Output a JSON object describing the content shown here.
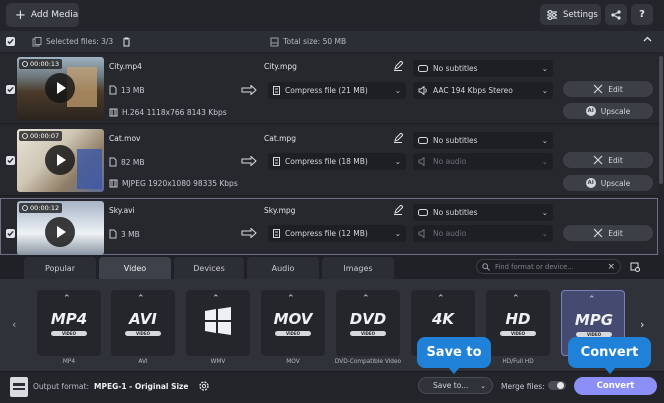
{
  "toolbar": {
    "add_media": "Add Media",
    "settings": "Settings",
    "help": "?"
  },
  "infobar": {
    "selected_files": "Selected files: 3/3",
    "total_size": "Total size: 50 MB"
  },
  "files": [
    {
      "duration": "00:00:13",
      "source_name": "City.mp4",
      "size": "13 MB",
      "codec_info": "H.264 1118x766 8143 Kbps",
      "output_name": "City.mpg",
      "compress": "Compress file (21 MB)",
      "subtitles": "No subtitles",
      "audio": "AAC 194 Kbps Stereo",
      "edit": "Edit",
      "upscale": "Upscale"
    },
    {
      "duration": "00:00:07",
      "source_name": "Cat.mov",
      "size": "82 MB",
      "codec_info": "MJPEG 1920x1080 98335 Kbps",
      "output_name": "Cat.mpg",
      "compress": "Compress file (18 MB)",
      "subtitles": "No subtitles",
      "audio": "No audio",
      "edit": "Edit",
      "upscale": "Upscale"
    },
    {
      "duration": "00:00:12",
      "source_name": "Sky.avi",
      "size": "3 MB",
      "output_name": "Sky.mpg",
      "compress": "Compress file (12 MB)",
      "subtitles": "No subtitles",
      "audio": "No audio",
      "edit": "Edit"
    }
  ],
  "format_tabs": [
    "Popular",
    "Video",
    "Devices",
    "Audio",
    "Images"
  ],
  "active_tab": "Video",
  "search": {
    "placeholder": "Find format or device..."
  },
  "formats": [
    {
      "logo": "MP4",
      "badge": "VIDEO",
      "label": "MP4"
    },
    {
      "logo": "AVI",
      "badge": "VIDEO",
      "label": "AVI"
    },
    {
      "logo": "",
      "badge": "",
      "label": "WMV"
    },
    {
      "logo": "MOV",
      "badge": "VIDEO",
      "label": "MOV"
    },
    {
      "logo": "DVD",
      "badge": "VIDEO",
      "label": "DVD-Compatible Video"
    },
    {
      "logo": "4K",
      "badge": "",
      "label": ""
    },
    {
      "logo": "HD",
      "badge": "VIDEO",
      "label": "HD/Full HD"
    },
    {
      "logo": "MPG",
      "badge": "VIDEO",
      "label": ""
    }
  ],
  "bottom": {
    "output_format_label": "Output format:",
    "output_format_value": "MPEG-1 - Original Size",
    "save_to": "Save to...",
    "merge_files": "Merge files:",
    "convert": "Convert"
  },
  "tooltips": {
    "save_to": "Save to",
    "convert": "Convert"
  },
  "colors": {
    "accent": "#8b8ff7",
    "tooltip": "#1f81d8",
    "background": "#23252b"
  }
}
